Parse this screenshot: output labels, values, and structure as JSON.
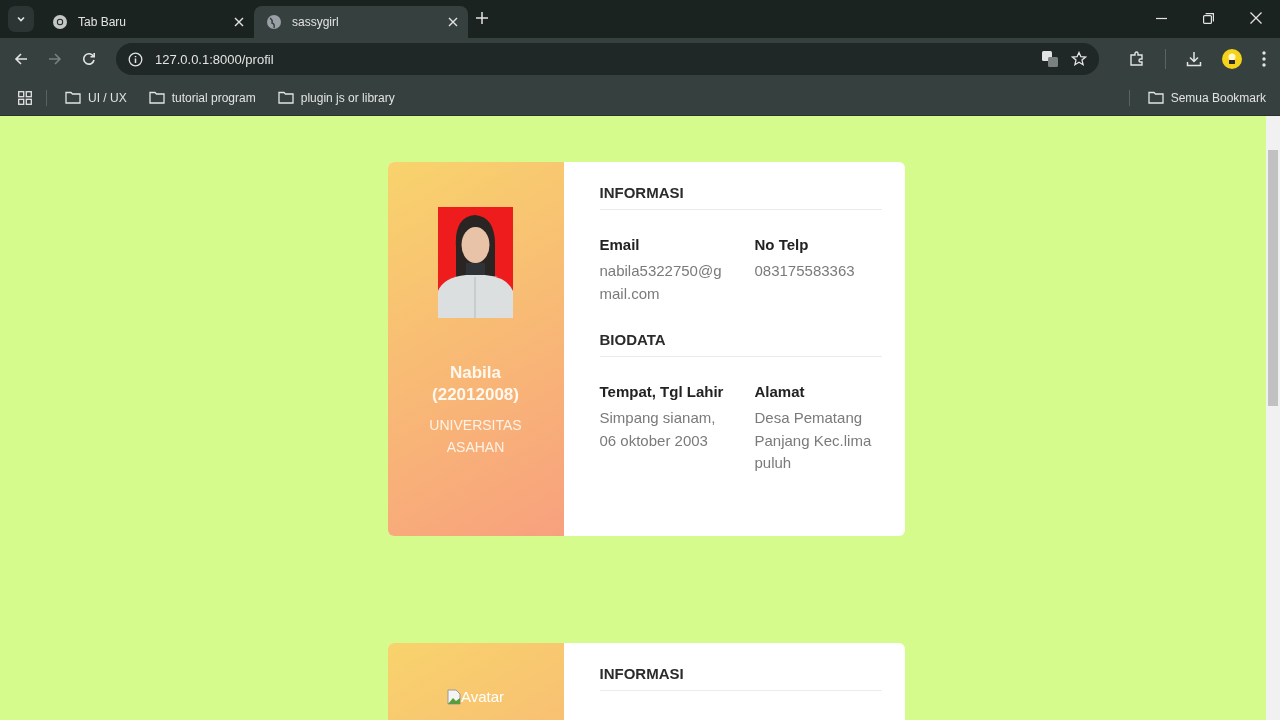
{
  "tabs": [
    {
      "title": "Tab Baru",
      "selected": false,
      "kind": "newtab"
    },
    {
      "title": "sassygirl",
      "selected": true,
      "kind": "site"
    }
  ],
  "address": "127.0.0.1:8000/profil",
  "bookmarks": [
    {
      "label": "UI / UX"
    },
    {
      "label": "tutorial program"
    },
    {
      "label": "plugin js or library"
    }
  ],
  "all_bookmarks": "Semua Bookmark",
  "profiles": [
    {
      "photo": {
        "kind": "picture"
      },
      "name": "Nabila (22012008)",
      "university": "UNIVERSITAS ASAHAN",
      "sections": [
        {
          "title": "INFORMASI",
          "fields": [
            {
              "label": "Email",
              "value": "nabila5322750@gmail.com"
            },
            {
              "label": "No Telp",
              "value": "083175583363"
            }
          ]
        },
        {
          "title": "BIODATA",
          "fields": [
            {
              "label": "Tempat, Tgl Lahir",
              "value": "Simpang sianam, 06 oktober 2003"
            },
            {
              "label": "Alamat",
              "value": "Desa Pematang Panjang Kec.lima puluh"
            }
          ]
        }
      ]
    },
    {
      "photo": {
        "kind": "broken",
        "alt": "Avatar"
      },
      "sections": [
        {
          "title": "INFORMASI"
        }
      ]
    }
  ]
}
